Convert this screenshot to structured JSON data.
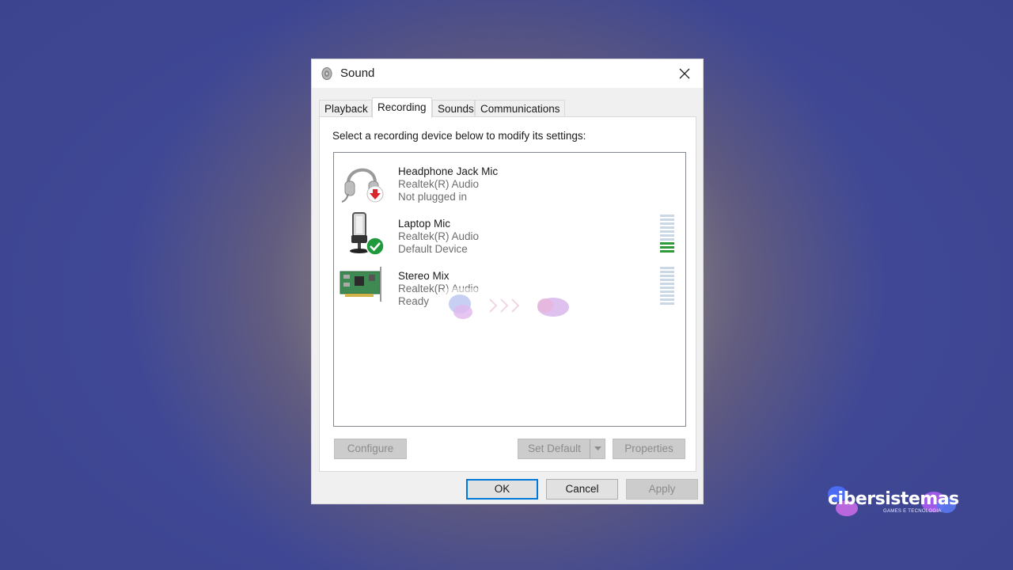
{
  "window": {
    "title": "Sound",
    "title_icon": "speaker-icon",
    "close_icon": "close-icon"
  },
  "tabs": [
    {
      "label": "Playback",
      "active": false
    },
    {
      "label": "Recording",
      "active": true
    },
    {
      "label": "Sounds",
      "active": false
    },
    {
      "label": "Communications",
      "active": false
    }
  ],
  "recording": {
    "instruction": "Select a recording device below to modify its settings:",
    "devices": [
      {
        "name": "Headphone Jack Mic",
        "driver": "Realtek(R) Audio",
        "status": "Not plugged in",
        "icon": "headset-icon",
        "badge": "red-down-arrow-icon",
        "level_bars_total": null,
        "level_bars_lit": null
      },
      {
        "name": "Laptop Mic",
        "driver": "Realtek(R) Audio",
        "status": "Default Device",
        "icon": "microphone-icon",
        "badge": "green-check-icon",
        "level_bars_total": 10,
        "level_bars_lit": 3
      },
      {
        "name": "Stereo Mix",
        "driver": "Realtek(R) Audio",
        "status": "Ready",
        "icon": "sound-card-icon",
        "badge": null,
        "level_bars_total": 10,
        "level_bars_lit": 0
      }
    ],
    "buttons": {
      "configure": "Configure",
      "set_default": "Set Default",
      "properties": "Properties"
    }
  },
  "footer": {
    "ok": "OK",
    "cancel": "Cancel",
    "apply": "Apply"
  },
  "branding": {
    "logo_text": "cibersistemas",
    "logo_sub": "GAMES E TECNOLOGIA"
  },
  "colors": {
    "accent": "#0078d7",
    "level_on": "#2e9a3a",
    "level_off": "#c9d7e6",
    "badge_red": "#d9262c",
    "badge_green": "#1e9a3c"
  }
}
